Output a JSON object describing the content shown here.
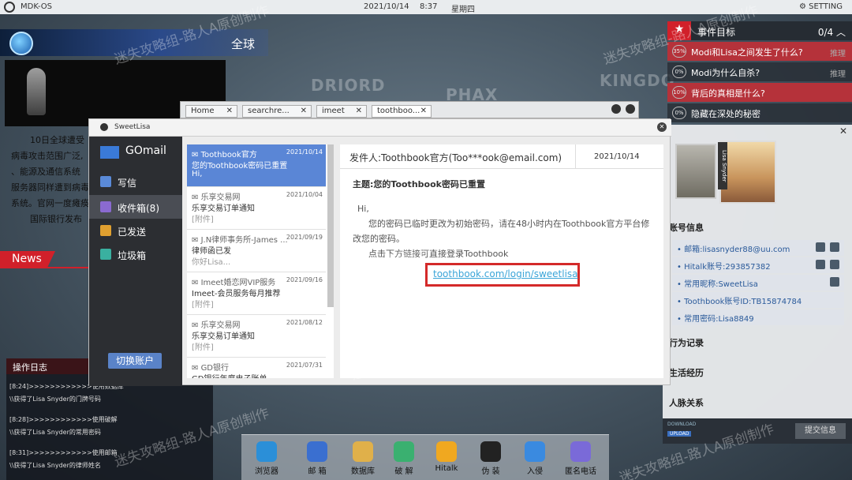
{
  "topbar": {
    "os": "MDK-OS",
    "date": "2021/10/14",
    "time": "8:37",
    "weekday": "星期四",
    "setting": "SETTING"
  },
  "map": {
    "labels": [
      "DRIORD",
      "PHAX",
      "KINGDO"
    ]
  },
  "news": {
    "title": "全球",
    "body": [
      "10日全球遭受",
      "病毒攻击范围广泛,",
      "、能源及通信系统",
      "服务器同样遭到病毒",
      "系统。官网一度瘫痪",
      "国际银行发布"
    ],
    "tag": "News"
  },
  "log": {
    "title": "操作日志",
    "lines": [
      "[8:24]>>>>>>>>>>>>使用数据库",
      "\\\\获得了Lisa Snyder的门牌号码",
      "[8:28]>>>>>>>>>>>>使用破解",
      "\\\\获得了Lisa Snyder的常用密码",
      "[8:31]>>>>>>>>>>>>使用邮箱",
      "\\\\获得了Lisa Snyder的律师姓名"
    ]
  },
  "tasks": {
    "title": "事件目标",
    "count": "0/4",
    "items": [
      {
        "pct": "35%",
        "text": "Modi和Lisa之间发生了什么?",
        "hint": "推理",
        "highlight": true
      },
      {
        "pct": "0%",
        "text": "Modi为什么自杀?",
        "hint": "推理",
        "highlight": false
      },
      {
        "pct": "10%",
        "text": "背后的真相是什么?",
        "hint": "",
        "highlight": true
      },
      {
        "pct": "0%",
        "text": "隐藏在深处的秘密",
        "hint": "",
        "highlight": false
      }
    ]
  },
  "profile": {
    "name_tag": "Lisa Snyder",
    "account_title": "账号信息",
    "accounts": [
      "邮箱:lisasnyder88@uu.com",
      "Hitalk账号:293857382",
      "常用昵称:SweetLisa",
      "Toothbook账号ID:TB15874784",
      "常用密码:Lisa8849"
    ],
    "sections": [
      "行为记录",
      "生活经历",
      "人脉关系"
    ],
    "footer": {
      "download": "DOWNLOAD",
      "upload": "UPLOAD",
      "submit": "提交信息"
    }
  },
  "browser": {
    "tabs": [
      "Home",
      "searchre...",
      "imeet",
      "toothboo..."
    ]
  },
  "mail": {
    "user": "SweetLisa",
    "app": "GOmail",
    "nav": [
      "写信",
      "收件箱(8)",
      "已发送",
      "垃圾箱"
    ],
    "switch": "切换账户",
    "list": [
      {
        "sender": "Toothbook官方",
        "date": "2021/10/14",
        "title": "您的Toothbook密码已重置",
        "preview": "Hi,"
      },
      {
        "sender": "乐享交易网",
        "date": "2021/10/04",
        "title": "乐享交易订单通知",
        "preview": "[附件]"
      },
      {
        "sender": "J.N律师事务所-James ...",
        "date": "2021/09/19",
        "title": "律师函已发",
        "preview": "你好Lisa..."
      },
      {
        "sender": "Imeet婚恋网VIP服务",
        "date": "2021/09/16",
        "title": "Imeet-会员服务每月推荐",
        "preview": "[附件]"
      },
      {
        "sender": "乐享交易网",
        "date": "2021/08/12",
        "title": "乐享交易订单通知",
        "preview": "[附件]"
      },
      {
        "sender": "GD银行",
        "date": "2021/07/31",
        "title": "GD银行年度电子账单",
        "preview": ""
      }
    ],
    "read": {
      "from": "发件人:Toothbook官方(Too***ook@email.com)",
      "date": "2021/10/14",
      "subject": "主题:您的Toothbook密码已重置",
      "body": [
        "Hi,",
        "您的密码已临时更改为初始密码，请在48小时内在Toothbook官方平台修改您的密码。",
        "点击下方链接可直接登录Toothbook"
      ],
      "link": "toothbook.com/login/sweetlisa"
    }
  },
  "dock": [
    {
      "label": "浏览器",
      "color": "#2b8fd8"
    },
    {
      "label": "邮 箱",
      "color": "#3a6fd0"
    },
    {
      "label": "数据库",
      "color": "#e0b04a"
    },
    {
      "label": "破 解",
      "color": "#3ab070"
    },
    {
      "label": "Hitalk",
      "color": "#f0a820"
    },
    {
      "label": "伪 装",
      "color": "#222222"
    },
    {
      "label": "入侵",
      "color": "#3a8ae0"
    },
    {
      "label": "匿名电话",
      "color": "#7a6ad8"
    }
  ],
  "watermark": "迷失攻略组-路人A原创制作"
}
